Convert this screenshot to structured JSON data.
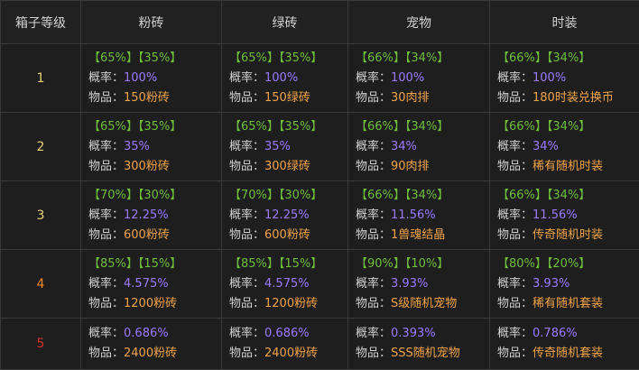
{
  "colors": {
    "background": "#1e1e1e",
    "border": "#3a3a3a",
    "percent_green": "#6fbf3b",
    "rate_purple": "#9b7bff",
    "item_orange": "#f0a44a",
    "level_1_3": "#e8d27a",
    "level_4": "#f08a2a",
    "level_5": "#d32f2f"
  },
  "headers": [
    "箱子等级",
    "粉砖",
    "绿砖",
    "宠物",
    "时装"
  ],
  "labels": {
    "rate": "概率：",
    "item": "物品："
  },
  "rows": [
    {
      "level": "1",
      "level_color": "#e8d27a",
      "cells": [
        {
          "split_a": "【65%】",
          "split_b": "【35%】",
          "rate": "100%",
          "item": "150粉砖"
        },
        {
          "split_a": "【65%】",
          "split_b": "【35%】",
          "rate": "100%",
          "item": "150绿砖"
        },
        {
          "split_a": "【66%】",
          "split_b": "【34%】",
          "rate": "100%",
          "item": "30肉排"
        },
        {
          "split_a": "【66%】",
          "split_b": "【34%】",
          "rate": "100%",
          "item": "180时装兑换币"
        }
      ]
    },
    {
      "level": "2",
      "level_color": "#e8d27a",
      "cells": [
        {
          "split_a": "【65%】",
          "split_b": "【35%】",
          "rate": "35%",
          "item": "300粉砖"
        },
        {
          "split_a": "【65%】",
          "split_b": "【35%】",
          "rate": "35%",
          "item": "300绿砖"
        },
        {
          "split_a": "【66%】",
          "split_b": "【34%】",
          "rate": "34%",
          "item": "90肉排"
        },
        {
          "split_a": "【66%】",
          "split_b": "【34%】",
          "rate": "34%",
          "item": "稀有随机时装"
        }
      ]
    },
    {
      "level": "3",
      "level_color": "#e8d27a",
      "cells": [
        {
          "split_a": "【70%】",
          "split_b": "【30%】",
          "rate": "12.25%",
          "item": "600粉砖"
        },
        {
          "split_a": "【70%】",
          "split_b": "【30%】",
          "rate": "12.25%",
          "item": "600粉砖"
        },
        {
          "split_a": "【66%】",
          "split_b": "【34%】",
          "rate": "11.56%",
          "item": "1兽魂结晶"
        },
        {
          "split_a": "【66%】",
          "split_b": "【34%】",
          "rate": "11.56%",
          "item": "传奇随机时装"
        }
      ]
    },
    {
      "level": "4",
      "level_color": "#f08a2a",
      "cells": [
        {
          "split_a": "【85%】",
          "split_b": "【15%】",
          "rate": "4.575%",
          "item": "1200粉砖"
        },
        {
          "split_a": "【85%】",
          "split_b": "【15%】",
          "rate": "4.575%",
          "item": "1200粉砖"
        },
        {
          "split_a": "【90%】",
          "split_b": "【10%】",
          "rate": "3.93%",
          "item": "S级随机宠物"
        },
        {
          "split_a": "【80%】",
          "split_b": "【20%】",
          "rate": "3.93%",
          "item": "稀有随机套装"
        }
      ]
    },
    {
      "level": "5",
      "level_color": "#d32f2f",
      "cells": [
        {
          "rate": "0.686%",
          "item": "2400粉砖"
        },
        {
          "rate": "0.686%",
          "item": "2400粉砖"
        },
        {
          "rate": "0.393%",
          "item": "SSS随机宠物"
        },
        {
          "rate": "0.786%",
          "item": "传奇随机套装"
        }
      ]
    }
  ]
}
